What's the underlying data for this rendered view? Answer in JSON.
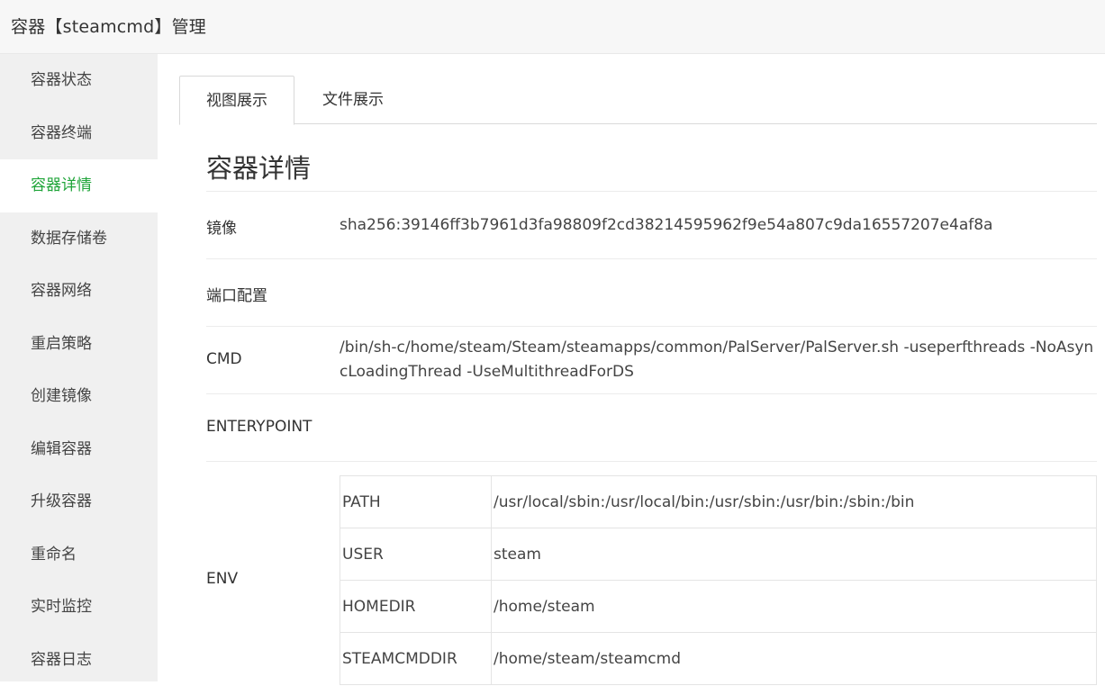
{
  "header": {
    "title": "容器【steamcmd】管理"
  },
  "sidebar": {
    "items": [
      {
        "label": "容器状态"
      },
      {
        "label": "容器终端"
      },
      {
        "label": "容器详情"
      },
      {
        "label": "数据存储卷"
      },
      {
        "label": "容器网络"
      },
      {
        "label": "重启策略"
      },
      {
        "label": "创建镜像"
      },
      {
        "label": "编辑容器"
      },
      {
        "label": "升级容器"
      },
      {
        "label": "重命名"
      },
      {
        "label": "实时监控"
      },
      {
        "label": "容器日志"
      }
    ],
    "active_index": 2
  },
  "tabs": [
    {
      "label": "视图展示",
      "active": true
    },
    {
      "label": "文件展示",
      "active": false
    }
  ],
  "details": {
    "title": "容器详情",
    "image_label": "镜像",
    "image_value": "sha256:39146ff3b7961d3fa98809f2cd38214595962f9e54a807c9da16557207e4af8a",
    "ports_label": "端口配置",
    "ports_value": "",
    "cmd_label": "CMD",
    "cmd_value": "/bin/sh-c/home/steam/Steam/steamapps/common/PalServer/PalServer.sh -useperfthreads -NoAsyncLoadingThread -UseMultithreadForDS",
    "entrypoint_label": "ENTERYPOINT",
    "entrypoint_value": "",
    "env_label": "ENV",
    "env": [
      {
        "key": "PATH",
        "value": "/usr/local/sbin:/usr/local/bin:/usr/sbin:/usr/bin:/sbin:/bin"
      },
      {
        "key": "USER",
        "value": "steam"
      },
      {
        "key": "HOMEDIR",
        "value": "/home/steam"
      },
      {
        "key": "STEAMCMDDIR",
        "value": "/home/steam/steamcmd"
      }
    ]
  },
  "colors": {
    "accent": "#20a53a",
    "sidebar_bg": "#f0f0f0",
    "header_bg": "#f7f7f7"
  }
}
